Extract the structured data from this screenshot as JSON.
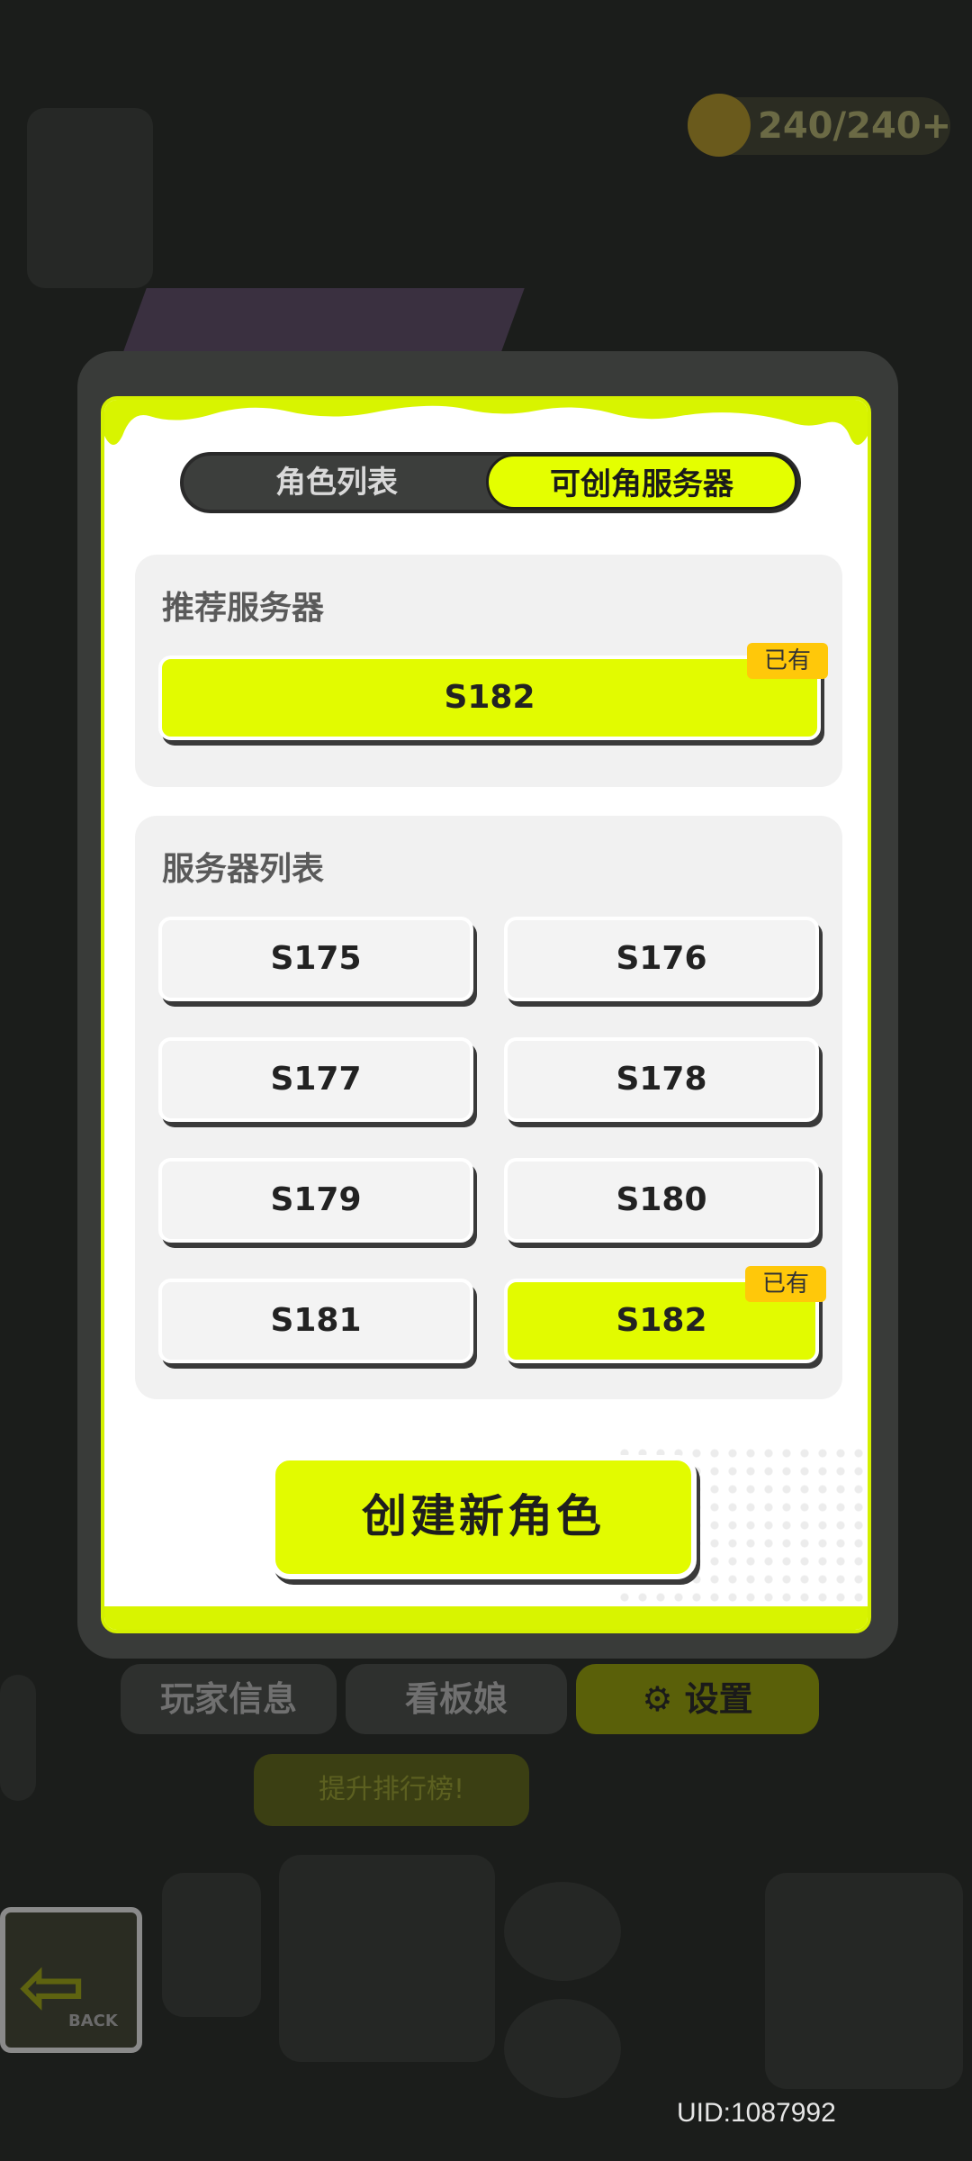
{
  "background": {
    "energy": "240/240+",
    "menu": {
      "player_info": "玩家信息",
      "mascot": "看板娘",
      "settings": "设置"
    },
    "upgrade": "提升排行榜!",
    "back": "BACK"
  },
  "dialog": {
    "tabs": [
      {
        "label": "角色列表",
        "active": false
      },
      {
        "label": "可创角服务器",
        "active": true
      }
    ],
    "recommended": {
      "title": "推荐服务器",
      "server": {
        "name": "S182",
        "owned": true,
        "badge": "已有"
      }
    },
    "server_list": {
      "title": "服务器列表",
      "servers": [
        {
          "name": "S175",
          "owned": false
        },
        {
          "name": "S176",
          "owned": false
        },
        {
          "name": "S177",
          "owned": false
        },
        {
          "name": "S178",
          "owned": false
        },
        {
          "name": "S179",
          "owned": false
        },
        {
          "name": "S180",
          "owned": false
        },
        {
          "name": "S181",
          "owned": false
        },
        {
          "name": "S182",
          "owned": true,
          "badge": "已有"
        }
      ]
    },
    "create_button": "创建新角色"
  },
  "uid": "UID:1087992",
  "colors": {
    "accent": "#e2fb00",
    "badge": "#ffc80a",
    "frame": "#393b39"
  }
}
